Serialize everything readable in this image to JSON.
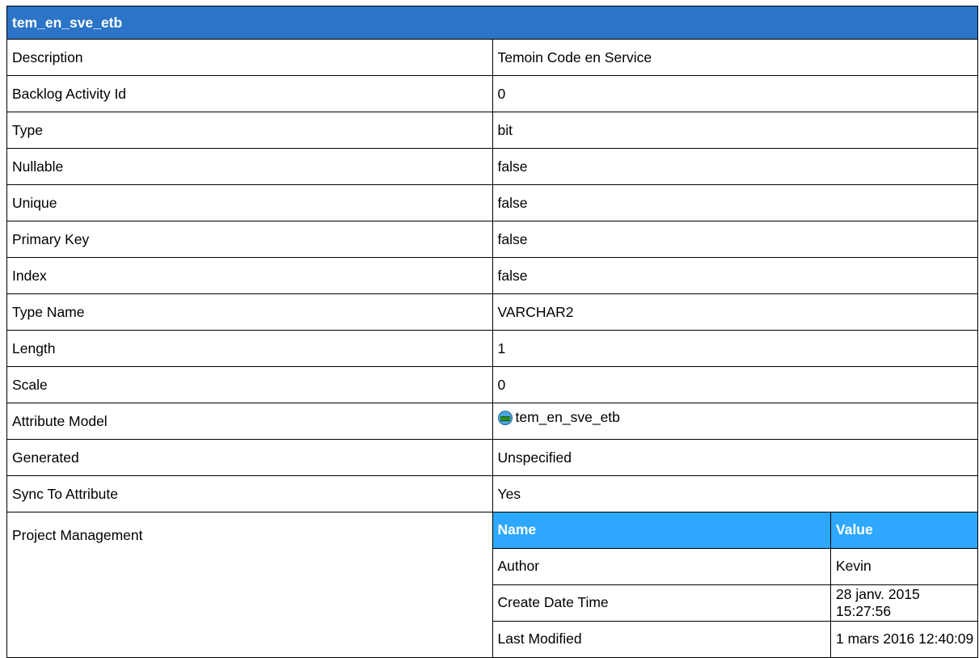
{
  "title": "tem_en_sve_etb",
  "rows": [
    {
      "key": "Description",
      "value": "Temoin Code en Service"
    },
    {
      "key": "Backlog Activity Id",
      "value": "0"
    },
    {
      "key": "Type",
      "value": "bit"
    },
    {
      "key": "Nullable",
      "value": "false"
    },
    {
      "key": "Unique",
      "value": "false"
    },
    {
      "key": "Primary Key",
      "value": "false"
    },
    {
      "key": "Index",
      "value": "false"
    },
    {
      "key": "Type Name",
      "value": "VARCHAR2"
    },
    {
      "key": "Length",
      "value": "1"
    },
    {
      "key": "Scale",
      "value": "0"
    }
  ],
  "attribute_model": {
    "key": "Attribute Model",
    "value": "tem_en_sve_etb",
    "icon": "attribute-icon"
  },
  "rows2": [
    {
      "key": "Generated",
      "value": "Unspecified"
    },
    {
      "key": "Sync To Attribute",
      "value": "Yes"
    }
  ],
  "project_management": {
    "key": "Project Management",
    "headers": {
      "name": "Name",
      "value": "Value"
    },
    "items": [
      {
        "name": "Author",
        "value": "Kevin"
      },
      {
        "name": "Create Date Time",
        "value": "28 janv. 2015 15:27:56"
      },
      {
        "name": "Last Modified",
        "value": "1 mars 2016 12:40:09"
      }
    ]
  },
  "colors": {
    "title_bg": "#2b74c7",
    "subheader_bg": "#2ea8ff"
  }
}
